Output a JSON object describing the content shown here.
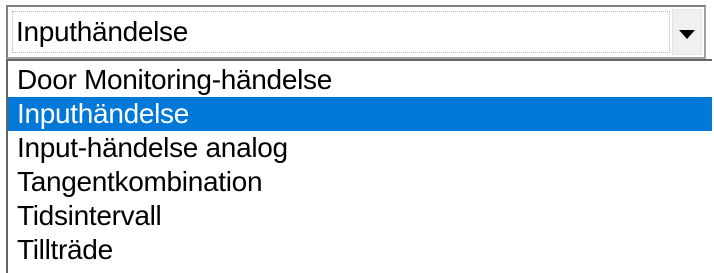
{
  "combo": {
    "value": "Inputhändelse",
    "arrow_icon": "chevron-down-icon"
  },
  "list": {
    "items": [
      {
        "label": "Door Monitoring-händelse",
        "selected": false
      },
      {
        "label": "Inputhändelse",
        "selected": true
      },
      {
        "label": "Input-händelse analog",
        "selected": false
      },
      {
        "label": "Tangentkombination",
        "selected": false
      },
      {
        "label": "Tidsintervall",
        "selected": false
      },
      {
        "label": "Tillträde",
        "selected": false
      }
    ]
  },
  "colors": {
    "selection_bg": "#0078d7",
    "selection_text": "#ffffff",
    "text": "#000000"
  }
}
